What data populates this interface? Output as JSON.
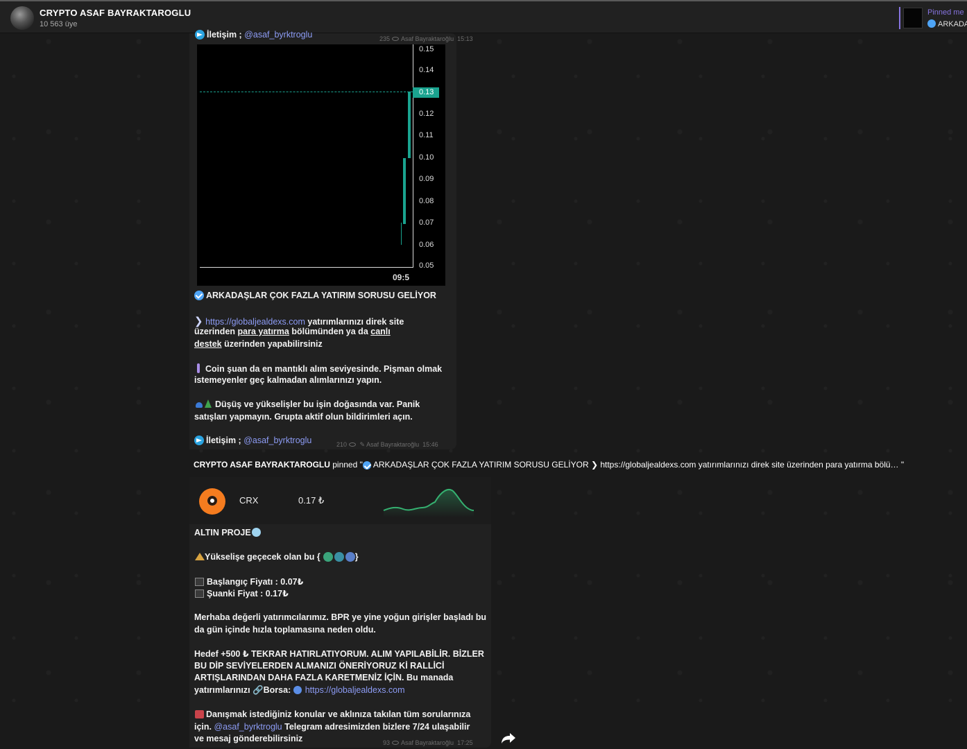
{
  "header": {
    "title": "CRYPTO ASAF BAYRAKTAROGLU",
    "subtitle": "10 563 üye",
    "pinned_label": "Pinned me",
    "pinned_text": "ARKADA"
  },
  "msg1": {
    "top_contact_prefix": "İletişim ; ",
    "top_contact_handle": "@asaf_byrktroglu",
    "top_meta": {
      "views": "235",
      "author": "Asaf Bayraktaroğlu",
      "time": "15:13"
    },
    "chart": {
      "ticks": [
        "0.15",
        "0.14",
        "0.13",
        "0.12",
        "0.11",
        "0.10",
        "0.09",
        "0.08",
        "0.07",
        "0.06",
        "0.05"
      ],
      "current_price": "0.13",
      "time_label": "09:5"
    },
    "headline": "ARKADAŞLAR ÇOK FAZLA YATIRIM SORUSU GELİYOR",
    "p1": {
      "arrow": "❯",
      "link": "https://globaljealdexs.com",
      "t1": " yatırımlarınızı direk site",
      "t2": "üzerinden ",
      "u1": "para yatırma",
      "t3": " bölümünden ya da ",
      "u2": "canlı",
      "u3": "destek",
      "t4": " üzerinden yapabilirsiniz"
    },
    "p2": {
      "l1": "Coin şuan da en mantıklı alım seviyesinde. Pişman olmak",
      "l2": "istemeyenler geç kalmadan alımlarınızı yapın."
    },
    "p3": {
      "l1": "Düşüş ve yükselişler bu işin doğasında var. Panik",
      "l2": "satışları yapmayın. Grupta aktif olun bildirimleri açın."
    },
    "contact_prefix": "İletişim ; ",
    "contact_handle": "@asaf_byrktroglu",
    "meta": {
      "views": "210",
      "author": "Asaf Bayraktaroğlu",
      "time": "15:46"
    }
  },
  "pin_notice": {
    "actor": "CRYPTO ASAF BAYRAKTAROGLU",
    "verb": " pinned \"",
    "text": "ARKADAŞLAR ÇOK FAZLA YATIRIM SORUSU GELİYOR ❯ https://globaljealdexs.com yatırımlarınızı direk site üzerinden para yatırma bölü… \""
  },
  "msg2": {
    "crx_name": "CRX",
    "crx_price": "0.17 ₺",
    "title": "ALTIN PROJE",
    "l_rise": "Yükselişe geçecek olan bu  {",
    "l_rise_end": "}",
    "start_price": "Başlangıç Fiyatı : 0.07₺",
    "current_price": "Şuanki Fiyat :  0.17₺",
    "para1_l1": "Merhaba değerli yatırımcılarımız. BPR ye yine yoğun girişler başladı bu",
    "para1_l2": "da gün içinde hızla toplamasına neden oldu.",
    "para2_l1": "Hedef +500 ₺ TEKRAR HATIRLATIYORUM. ALIM YAPILABİLİR. BİZLER",
    "para2_l2": "BU DİP SEVİYELERDEN ALMANIZI ÖNERİYORUZ Kİ RALLİCİ",
    "para2_l3": "ARTIŞLARINDAN DAHA FAZLA KARETMENİZ İÇİN. Bu manada",
    "para2_l4a": " yatırımlarınızı ",
    "para2_l4b": "Borsa: ",
    "para2_link": "https://globaljealdexs.com",
    "para3_l1": "Danışmak istediğiniz konular ve aklınıza takılan tüm sorularınıza",
    "para3_l2a": "için.  ",
    "para3_handle": "@asaf_byrktroglu",
    "para3_l2b": " Telegram adresimizden bizlere 7/24 ulaşabilir",
    "para3_l3": "ve mesaj gönderebilirsiniz",
    "meta": {
      "views": "93",
      "author": "Asaf Bayraktaroğlu",
      "time": "17:25"
    }
  },
  "colors": {
    "accent": "#8774e1",
    "link": "#8d9cf5",
    "chart_green": "#1aa38f",
    "bubble": "#212121"
  }
}
